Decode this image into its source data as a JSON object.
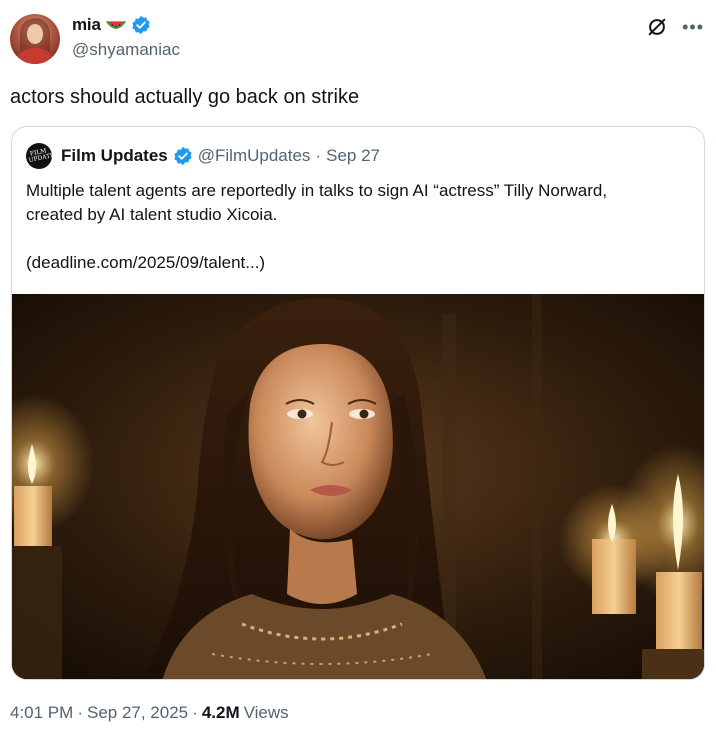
{
  "author": {
    "display_name": "mia",
    "handle": "@shyamaniac",
    "name_emoji": "watermelon-icon",
    "verified": true
  },
  "tweet": {
    "text": "actors should actually go back on strike"
  },
  "quote": {
    "display_name": "Film Updates",
    "handle": "@FilmUpdates",
    "separator": "·",
    "date": "Sep 27",
    "verified": true,
    "avatar_text": "FILM UPDATES",
    "text_line1": "Multiple talent agents are reportedly in talks to sign AI “actress” Tilly Norward,",
    "text_line2": "created by AI talent studio Xicoia.",
    "link_text": "(deadline.com/2025/09/talent...)"
  },
  "meta": {
    "time": "4:01 PM",
    "sep1": "·",
    "date": "Sep 27, 2025",
    "sep2": "·",
    "views_count": "4.2M",
    "views_label": "Views"
  },
  "colors": {
    "verified_blue": "#1d9bf0",
    "secondary_text": "#536471",
    "border": "#cfd9de"
  }
}
